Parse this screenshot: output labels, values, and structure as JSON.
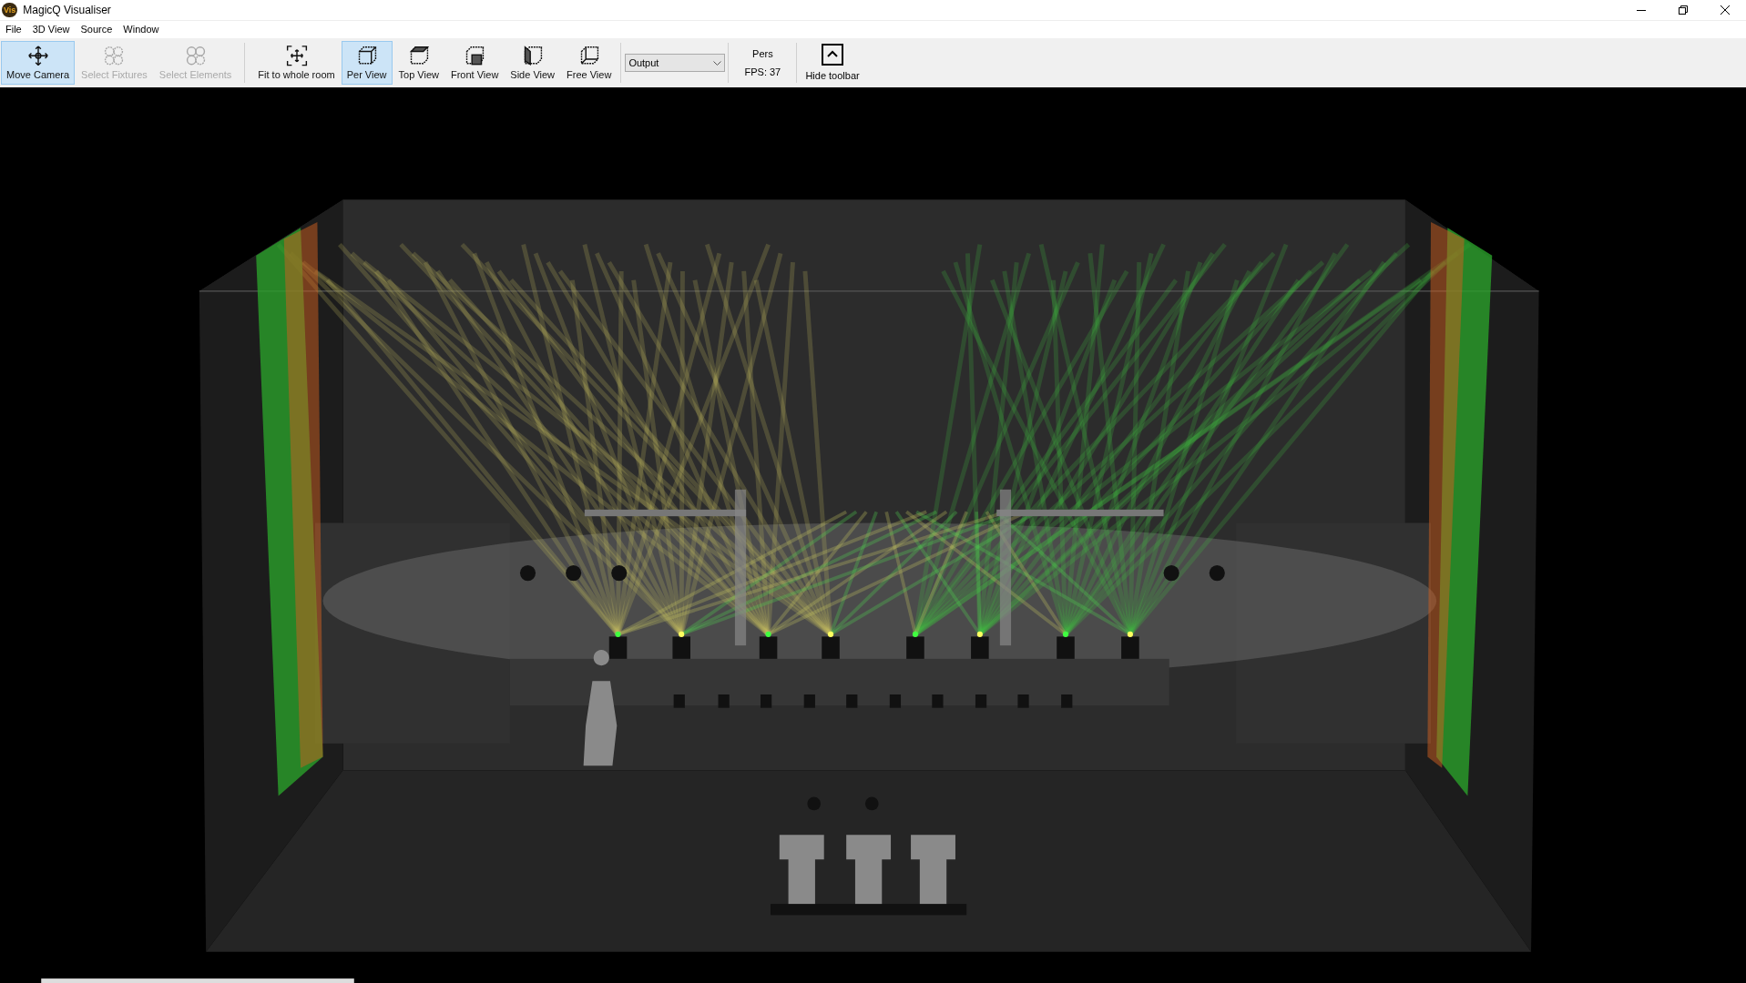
{
  "window": {
    "title": "MagicQ Visualiser",
    "app_icon_text": "Vis"
  },
  "menu": [
    "File",
    "3D View",
    "Source",
    "Window"
  ],
  "toolbar": {
    "groups": [
      [
        {
          "label": "Move Camera",
          "selected": true,
          "disabled": false
        },
        {
          "label": "Select Fixtures",
          "selected": false,
          "disabled": true
        },
        {
          "label": "Select Elements",
          "selected": false,
          "disabled": true
        }
      ],
      [
        {
          "label": "Fit to whole room",
          "selected": false,
          "disabled": false
        },
        {
          "label": "Per View",
          "selected": true,
          "disabled": false
        },
        {
          "label": "Top View",
          "selected": false,
          "disabled": false
        },
        {
          "label": "Front View",
          "selected": false,
          "disabled": false
        },
        {
          "label": "Side View",
          "selected": false,
          "disabled": false
        },
        {
          "label": "Free View",
          "selected": false,
          "disabled": false
        }
      ]
    ],
    "source_select": {
      "value": "Output"
    },
    "projection": "Pers",
    "fps": "FPS: 37",
    "hide_toolbar": {
      "label": "Hide toolbar"
    }
  }
}
